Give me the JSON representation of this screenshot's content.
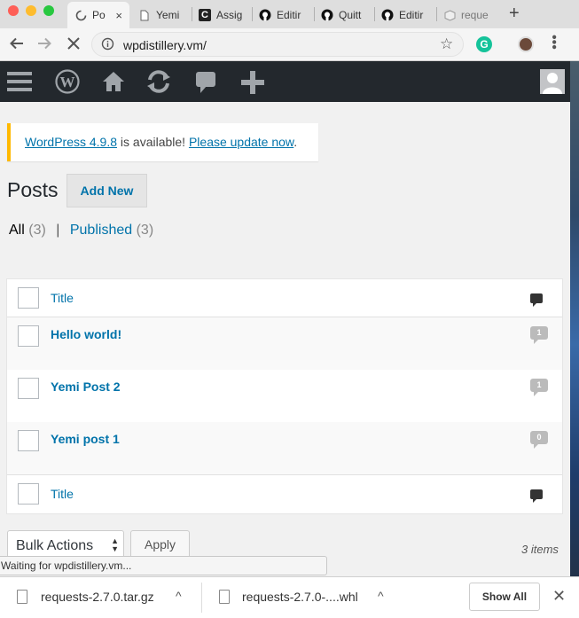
{
  "browser": {
    "tabs": [
      {
        "label": "Po",
        "active": true
      },
      {
        "label": "Yemi"
      },
      {
        "label": "Assig"
      },
      {
        "label": "Editir"
      },
      {
        "label": "Quitt"
      },
      {
        "label": "Editir"
      },
      {
        "label": "reque"
      }
    ],
    "url": "wpdistillery.vm/",
    "status_text": "Waiting for wpdistillery.vm..."
  },
  "notice": {
    "link1": "WordPress 4.9.8",
    "middle": " is available! ",
    "link2": "Please update now",
    "end": "."
  },
  "page": {
    "title": "Posts",
    "add_new": "Add New"
  },
  "filters": {
    "all_label": "All",
    "all_count": "(3)",
    "separator": "|",
    "published_label": "Published",
    "published_count": "(3)"
  },
  "table": {
    "header_title": "Title",
    "footer_title": "Title",
    "rows": [
      {
        "title": "Hello world!",
        "comments": "1"
      },
      {
        "title": "Yemi Post 2",
        "comments": "1"
      },
      {
        "title": "Yemi post 1",
        "comments": "0"
      }
    ]
  },
  "bulk": {
    "select_label": "Bulk Actions",
    "apply": "Apply",
    "item_count": "3 items"
  },
  "downloads": {
    "file1": "requests-2.7.0.tar.gz",
    "file2": "requests-2.7.0-....whl",
    "show_all": "Show All"
  },
  "colors": {
    "wp_blue": "#0073aa",
    "adminbar": "#23282d",
    "notice_border": "#ffb900"
  }
}
